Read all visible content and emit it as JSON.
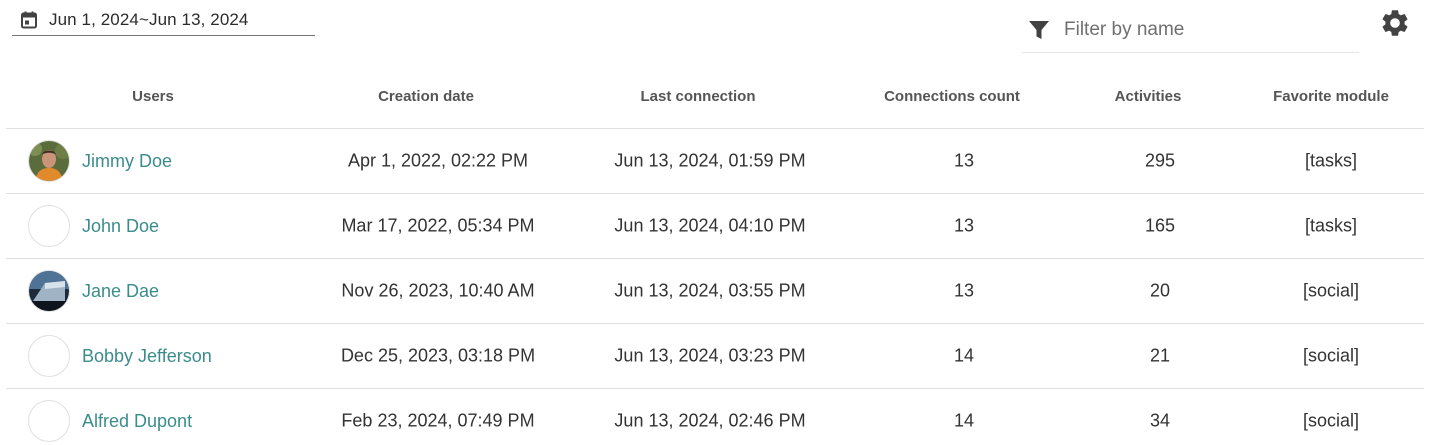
{
  "toolbar": {
    "date_range": "Jun 1, 2024~Jun 13, 2024",
    "filter_placeholder": "Filter by name"
  },
  "table": {
    "headers": {
      "users": "Users",
      "creation_date": "Creation date",
      "last_connection": "Last connection",
      "connections_count": "Connections count",
      "activities": "Activities",
      "favorite_module": "Favorite module"
    },
    "rows": [
      {
        "name": "Jimmy Doe",
        "avatar": "photo-man-orange",
        "creation_date": "Apr 1, 2022, 02:22 PM",
        "last_connection": "Jun 13, 2024, 01:59 PM",
        "connections_count": "13",
        "activities": "295",
        "favorite_module": "[tasks]"
      },
      {
        "name": "John Doe",
        "avatar": "empty",
        "creation_date": "Mar 17, 2022, 05:34 PM",
        "last_connection": "Jun 13, 2024, 04:10 PM",
        "connections_count": "13",
        "activities": "165",
        "favorite_module": "[tasks]"
      },
      {
        "name": "Jane Dae",
        "avatar": "photo-building",
        "creation_date": "Nov 26, 2023, 10:40 AM",
        "last_connection": "Jun 13, 2024, 03:55 PM",
        "connections_count": "13",
        "activities": "20",
        "favorite_module": "[social]"
      },
      {
        "name": "Bobby Jefferson",
        "avatar": "empty",
        "creation_date": "Dec 25, 2023, 03:18 PM",
        "last_connection": "Jun 13, 2024, 03:23 PM",
        "connections_count": "14",
        "activities": "21",
        "favorite_module": "[social]"
      },
      {
        "name": "Alfred Dupont",
        "avatar": "empty",
        "creation_date": "Feb 23, 2024, 07:49 PM",
        "last_connection": "Jun 13, 2024, 02:46 PM",
        "connections_count": "14",
        "activities": "34",
        "favorite_module": "[social]"
      }
    ]
  },
  "colors": {
    "link": "#3b8c8c",
    "icon": "#424242",
    "divider": "#e0e0e0",
    "header_text": "#555555"
  },
  "icons": {
    "date": "calendar-icon",
    "filter": "funnel-filter-icon",
    "settings": "gear-icon"
  }
}
